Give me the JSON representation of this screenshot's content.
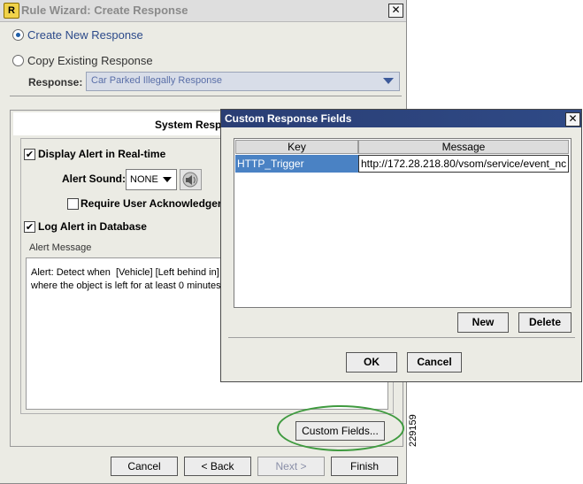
{
  "wizard": {
    "title": "Rule Wizard: Create Response",
    "logo_glyph": "R",
    "close_glyph": "✕",
    "option_create": "Create New Response",
    "option_copy": "Copy Existing Response",
    "response_label": "Response:",
    "response_value": "Car Parked Illegally Response",
    "panel_title": "System Resp",
    "display_alert_label": "Display Alert in Real-time",
    "alert_sound_label": "Alert Sound:",
    "alert_sound_value": "NONE",
    "require_ack_label": "Require User Acknowledger",
    "log_alert_label": "Log Alert in Database",
    "alert_message_label": "Alert Message",
    "alert_message_text": "Alert: Detect when  [Vehicle] [Left behind in]\nwhere the object is left for at least 0 minutes",
    "check_glyph": "✔",
    "custom_fields_button": "Custom Fields...",
    "cancel_button": "Cancel",
    "back_button": "< Back",
    "next_button": "Next >",
    "finish_button": "Finish"
  },
  "dialog": {
    "title": "Custom Response Fields",
    "close_glyph": "✕",
    "columns": [
      "Key",
      "Message"
    ],
    "rows": [
      {
        "key": "HTTP_Trigger",
        "message": "http://172.28.218.80/vsom/service/event_nc"
      }
    ],
    "new_button": "New",
    "delete_button": "Delete",
    "ok_button": "OK",
    "cancel_button": "Cancel"
  },
  "figure_number": "229159",
  "colors": {
    "dialog_titlebar": "#2a3e74",
    "row_selected": "#4a82c4",
    "highlight_ring": "#3f9a3f",
    "radio_selected": "#1f5fa8"
  },
  "state": {
    "selected_option": "Create New Response",
    "display_alert_checked": true,
    "require_ack_checked": false,
    "log_alert_checked": true,
    "next_enabled": false
  }
}
